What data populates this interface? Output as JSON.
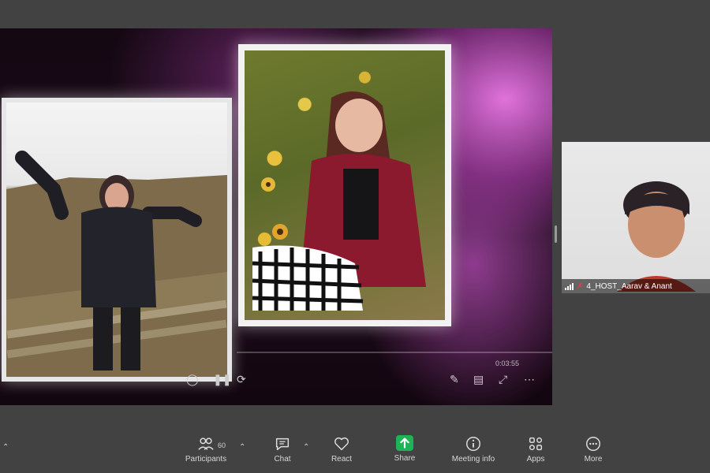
{
  "share": {
    "timestamp": "0:03:55"
  },
  "participant": {
    "name": "4_HOST_Aarav & Anant"
  },
  "toolbar": {
    "participants_label": "Participants",
    "participants_count": "60",
    "chat_label": "Chat",
    "react_label": "React",
    "share_label": "Share",
    "meeting_info_label": "Meeting info",
    "apps_label": "Apps",
    "more_label": "More"
  },
  "colors": {
    "share_green": "#1db356",
    "bg": "#424242",
    "accent_pink": "#e070e0"
  }
}
